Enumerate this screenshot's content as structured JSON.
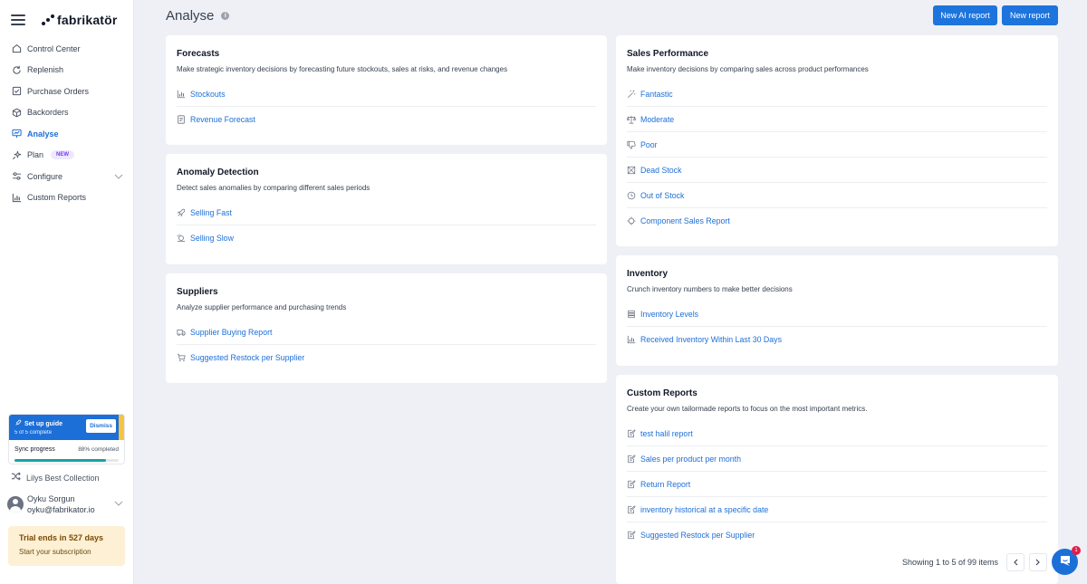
{
  "brand": {
    "name": "fabrikatör"
  },
  "sidebar": {
    "items": [
      {
        "label": "Control Center",
        "icon": "home-icon"
      },
      {
        "label": "Replenish",
        "icon": "refresh-icon"
      },
      {
        "label": "Purchase Orders",
        "icon": "clipboard-check-icon"
      },
      {
        "label": "Backorders",
        "icon": "box-icon"
      },
      {
        "label": "Analyse",
        "icon": "presentation-chart-icon",
        "active": true
      },
      {
        "label": "Plan",
        "icon": "sparkle-icon",
        "badge": "NEW"
      },
      {
        "label": "Configure",
        "icon": "sliders-icon"
      },
      {
        "label": "Custom Reports",
        "icon": "bar-chart-icon"
      }
    ],
    "setup": {
      "title": "Set up guide",
      "subtitle": "5 of 5 complete",
      "dismiss": "Dismiss",
      "sync_label": "Sync progress",
      "sync_status": "88% completed",
      "sync_progress": 0.88
    },
    "collection": "Lilys Best Collection",
    "user": {
      "name": "Oyku Sorgun",
      "email": "oyku@fabrikator.io"
    },
    "trial": {
      "title": "Trial ends in 527 days",
      "cta": "Start your subscription"
    }
  },
  "header": {
    "title": "Analyse",
    "new_ai_report": "New AI report",
    "new_report": "New report"
  },
  "cards": {
    "forecasts": {
      "title": "Forecasts",
      "desc": "Make strategic inventory decisions by forecasting future stockouts, sales at risks, and revenue changes",
      "links": [
        "Stockouts",
        "Revenue Forecast"
      ]
    },
    "anomaly": {
      "title": "Anomaly Detection",
      "desc": "Detect sales anomalies by comparing different sales periods",
      "links": [
        "Selling Fast",
        "Selling Slow"
      ]
    },
    "suppliers": {
      "title": "Suppliers",
      "desc": "Analyze supplier performance and purchasing trends",
      "links": [
        "Supplier Buying Report",
        "Suggested Restock per Supplier"
      ]
    },
    "sales": {
      "title": "Sales Performance",
      "desc": "Make inventory decisions by comparing sales across product performances",
      "links": [
        "Fantastic",
        "Moderate",
        "Poor",
        "Dead Stock",
        "Out of Stock",
        "Component Sales Report"
      ]
    },
    "inventory": {
      "title": "Inventory",
      "desc": "Crunch inventory numbers to make better decisions",
      "links": [
        "Inventory Levels",
        "Received Inventory Within Last 30 Days"
      ]
    },
    "custom": {
      "title": "Custom Reports",
      "desc": "Create your own tailormade reports to focus on the most important metrics.",
      "links": [
        "test halil report",
        "Sales per product per month",
        "Return Report",
        "inventory historical at a specific date",
        "Suggested Restock per Supplier"
      ],
      "pager": "Showing 1 to 5 of 99 items"
    }
  },
  "chat": {
    "badge": "1"
  },
  "colors": {
    "accent": "#1d74dc",
    "trial_bg": "#fdf0d5",
    "badge_bg": "#ede9fe"
  }
}
